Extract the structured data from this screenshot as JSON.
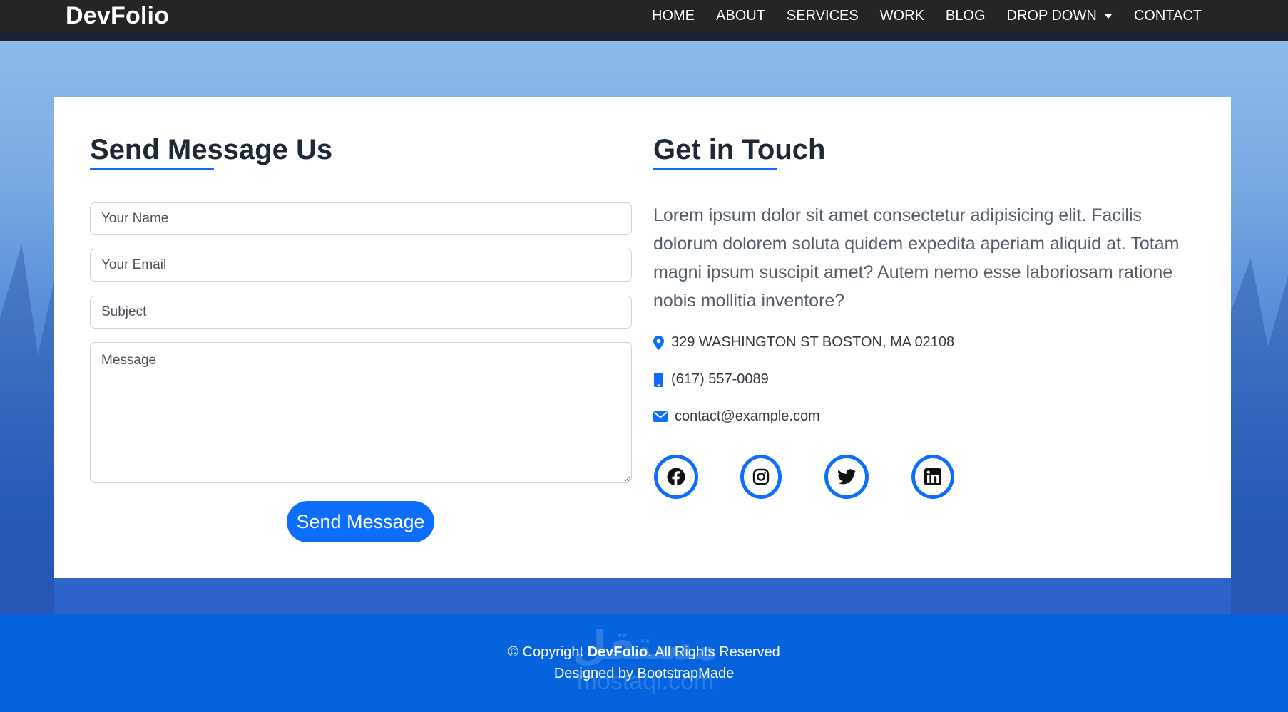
{
  "nav": {
    "brand": "DevFolio",
    "links": [
      "HOME",
      "ABOUT",
      "SERVICES",
      "WORK",
      "BLOG",
      "DROP DOWN",
      "CONTACT"
    ]
  },
  "form": {
    "title": "Send Message Us",
    "name_placeholder": "Your Name",
    "email_placeholder": "Your Email",
    "subject_placeholder": "Subject",
    "message_placeholder": "Message",
    "submit_label": "Send Message"
  },
  "info": {
    "title": "Get in Touch",
    "description": "Lorem ipsum dolor sit amet consectetur adipisicing elit. Facilis dolorum dolorem soluta quidem expedita aperiam aliquid at. Totam magni ipsum suscipit amet? Autem nemo esse laboriosam ratione nobis mollitia inventore?",
    "address": "329 WASHINGTON ST BOSTON, MA 02108",
    "phone": "(617) 557-0089",
    "email": "contact@example.com",
    "socials": [
      "facebook-icon",
      "instagram-icon",
      "twitter-icon",
      "linkedin-icon"
    ]
  },
  "footer": {
    "copyright_prefix": "© Copyright ",
    "brand": "DevFolio",
    "copyright_suffix": ". All Rights Reserved",
    "designed_by": "Designed by BootstrapMade",
    "watermark_arabic": "مستقل",
    "watermark_latin": "mostaql.com"
  },
  "colors": {
    "accent": "#0d6efd",
    "navbar": "#252525",
    "footer": "#0563de"
  }
}
